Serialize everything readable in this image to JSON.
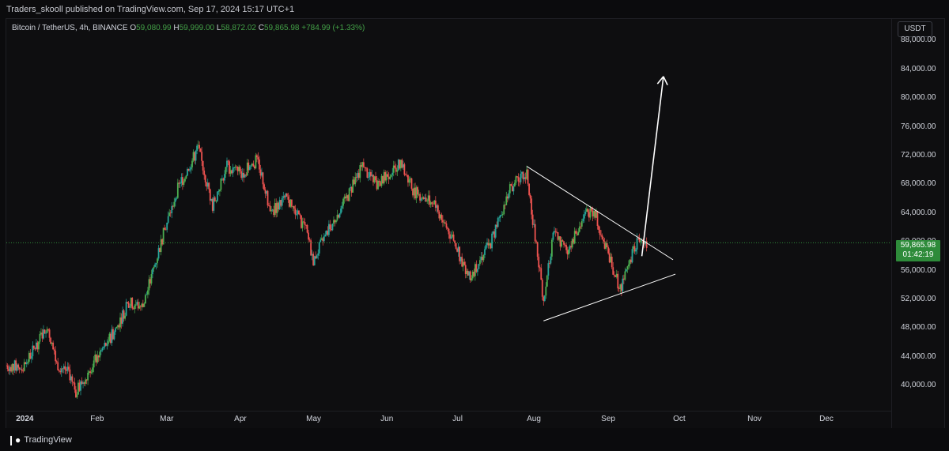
{
  "header": {
    "published": "Traders_skooll published on TradingView.com, Sep 17, 2024 15:17 UTC+1"
  },
  "legend": {
    "symbol": "Bitcoin / TetherUS, 4h, BINANCE",
    "o_label": "O",
    "o_value": "59,080.99",
    "h_label": "H",
    "h_value": "59,999.00",
    "l_label": "L",
    "l_value": "58,872.02",
    "c_label": "C",
    "c_value": "59,865.98",
    "change": "+784.99 (+1.33%)"
  },
  "currency_label": "USDT",
  "price_badge": {
    "price": "59,865.98",
    "countdown": "01:42:19"
  },
  "brand": {
    "name": "TradingView"
  },
  "colors": {
    "up": "#26a69a",
    "up_alt": "#4caf50",
    "down": "#ef5350",
    "background": "#0e0e10",
    "drawing": "#ffffff",
    "price_badge": "#2e8b3a"
  },
  "chart_data": {
    "type": "line",
    "title": "Bitcoin / TetherUS, 4h, BINANCE",
    "xlabel": "",
    "ylabel": "",
    "y_ticks": [
      "40,000.00",
      "44,000.00",
      "48,000.00",
      "52,000.00",
      "56,000.00",
      "60,000.00",
      "64,000.00",
      "68,000.00",
      "72,000.00",
      "76,000.00",
      "80,000.00",
      "84,000.00",
      "88,000.00"
    ],
    "x_ticks": [
      "2024",
      "Feb",
      "Mar",
      "Apr",
      "May",
      "Jun",
      "Jul",
      "Aug",
      "Sep",
      "Oct",
      "Nov",
      "Dec"
    ],
    "ylim": [
      36500,
      91000
    ],
    "xlim": [
      "2023-12-25",
      "2024-12-28"
    ],
    "last_price": 59865.98,
    "series": [
      {
        "x": [
          "2023-12-25",
          "2024-01-01",
          "2024-01-08",
          "2024-01-11",
          "2024-01-15",
          "2024-01-20",
          "2024-01-23",
          "2024-01-30",
          "2024-02-08",
          "2024-02-14",
          "2024-02-20",
          "2024-02-28",
          "2024-03-05",
          "2024-03-10",
          "2024-03-14",
          "2024-03-20",
          "2024-03-26",
          "2024-04-01",
          "2024-04-08",
          "2024-04-13",
          "2024-04-20",
          "2024-04-28",
          "2024-05-01",
          "2024-05-08",
          "2024-05-15",
          "2024-05-21",
          "2024-05-28",
          "2024-06-06",
          "2024-06-12",
          "2024-06-20",
          "2024-06-28",
          "2024-07-05",
          "2024-07-14",
          "2024-07-22",
          "2024-07-29",
          "2024-08-05",
          "2024-08-09",
          "2024-08-15",
          "2024-08-23",
          "2024-08-26",
          "2024-09-01",
          "2024-09-06",
          "2024-09-10",
          "2024-09-13",
          "2024-09-17"
        ],
        "values": [
          42800,
          42500,
          46500,
          48500,
          43000,
          42000,
          39000,
          43000,
          47500,
          51500,
          51000,
          60500,
          67000,
          70500,
          73000,
          65000,
          70500,
          69500,
          71500,
          64000,
          66000,
          61500,
          57500,
          62000,
          66000,
          70500,
          68000,
          71000,
          67000,
          65500,
          60500,
          55000,
          60000,
          67500,
          69500,
          52000,
          61000,
          59000,
          64000,
          64500,
          58000,
          53500,
          57500,
          60000,
          59866
        ]
      }
    ],
    "annotations": [
      {
        "type": "trendline",
        "x": [
          "2024-07-29",
          "2024-09-28"
        ],
        "y": [
          70500,
          57500
        ]
      },
      {
        "type": "trendline",
        "x": [
          "2024-08-05",
          "2024-09-29"
        ],
        "y": [
          49000,
          55500
        ]
      },
      {
        "type": "arrow",
        "x": [
          "2024-09-15",
          "2024-09-24"
        ],
        "y": [
          58000,
          83000
        ]
      }
    ]
  }
}
